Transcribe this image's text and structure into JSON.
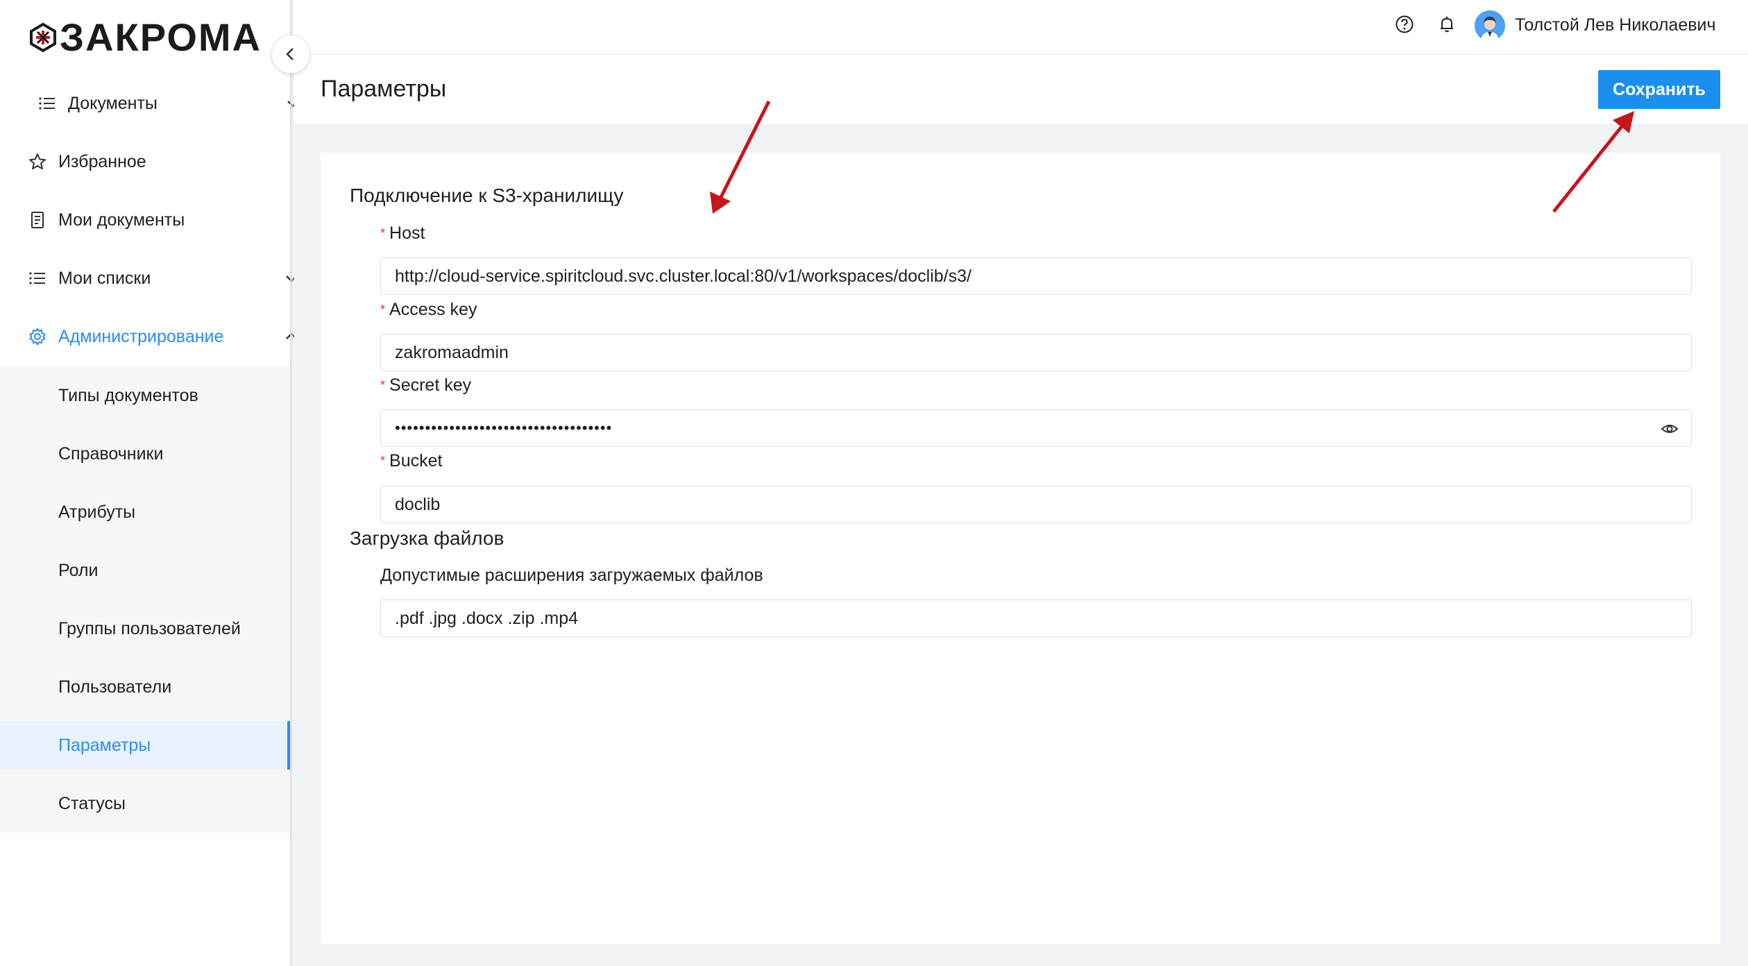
{
  "app": {
    "logo_text": "ЗАКРОМА",
    "user_name": "Толстой Лев Николаевич"
  },
  "sidebar": {
    "items": [
      {
        "label": "Документы",
        "icon": "list-icon",
        "chevron": "down"
      },
      {
        "label": "Избранное",
        "icon": "star-icon"
      },
      {
        "label": "Мои документы",
        "icon": "document-icon"
      },
      {
        "label": "Мои списки",
        "icon": "list-icon",
        "chevron": "down"
      },
      {
        "label": "Администрирование",
        "icon": "gear-icon",
        "chevron": "up",
        "active": true
      }
    ],
    "subitems": [
      {
        "label": "Типы документов"
      },
      {
        "label": "Справочники"
      },
      {
        "label": "Атрибуты"
      },
      {
        "label": "Роли"
      },
      {
        "label": "Группы пользователей"
      },
      {
        "label": "Пользователи"
      },
      {
        "label": "Параметры",
        "selected": true
      },
      {
        "label": "Статусы"
      }
    ]
  },
  "page": {
    "title": "Параметры",
    "save_label": "Сохранить"
  },
  "s3": {
    "section_title": "Подключение к S3-хранилищу",
    "host_label": "Host",
    "host_value": "http://cloud-service.spiritcloud.svc.cluster.local:80/v1/workspaces/doclib/s3/",
    "access_key_label": "Access key",
    "access_key_value": "zakromaadmin",
    "secret_key_label": "Secret key",
    "secret_key_masked": "••••••••••••••••••••••••••••••••••••",
    "bucket_label": "Bucket",
    "bucket_value": "doclib"
  },
  "upload": {
    "section_title": "Загрузка файлов",
    "extensions_label": "Допустимые расширения загружаемых файлов",
    "extensions_value": ".pdf .jpg .docx .zip .mp4"
  },
  "colors": {
    "accent": "#1a8ff0",
    "active_text": "#2b8cf0",
    "required_mark": "#e8343a",
    "annotation_arrow": "#c8141b"
  }
}
